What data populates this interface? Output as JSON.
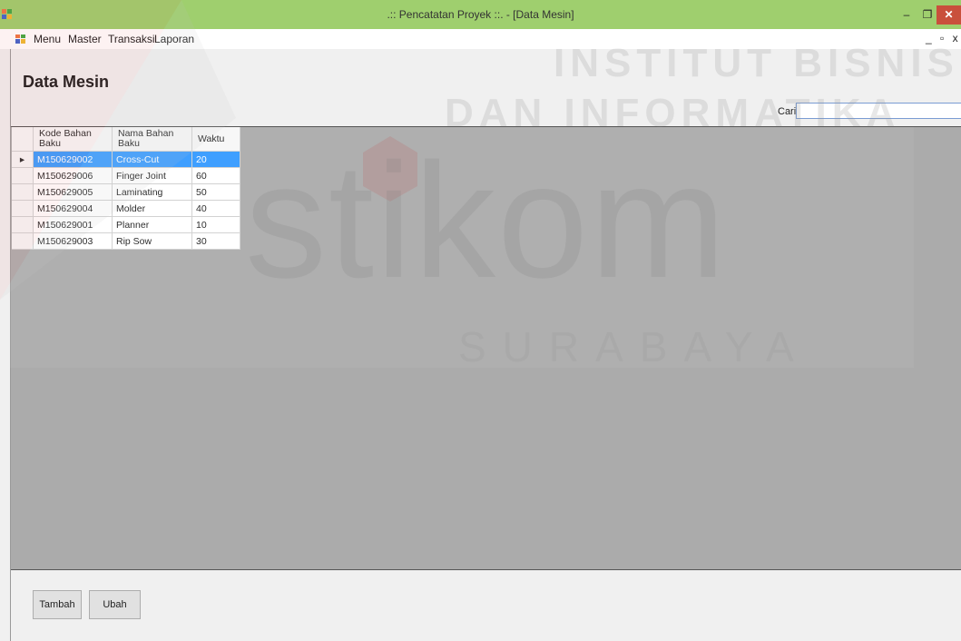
{
  "window": {
    "title": ".:: Pencatatan Proyek ::. - [Data Mesin]",
    "min": "–",
    "max": "❐",
    "close": "✕"
  },
  "menu": {
    "items": [
      "Menu",
      "Master",
      "Transaksi",
      "Laporan"
    ],
    "mdi_controls": "_ ▫ x"
  },
  "page": {
    "title": "Data Mesin"
  },
  "search": {
    "label": "Cari",
    "value": ""
  },
  "grid": {
    "columns": [
      "Kode Bahan Baku",
      "Nama Bahan Baku",
      "Waktu"
    ],
    "rows": [
      [
        "M150629002",
        "Cross-Cut",
        "20"
      ],
      [
        "M150629006",
        "Finger Joint",
        "60"
      ],
      [
        "M150629005",
        "Laminating",
        "50"
      ],
      [
        "M150629004",
        "Molder",
        "40"
      ],
      [
        "M150629001",
        "Planner",
        "10"
      ],
      [
        "M150629003",
        "Rip Sow",
        "30"
      ]
    ],
    "selected_row": 0,
    "row_indicator": "▸"
  },
  "buttons": {
    "add": "Tambah",
    "edit": "Ubah"
  },
  "watermark": {
    "line1": "INSTITUT BISNIS",
    "line2": "DAN INFORMATIKA",
    "brand": "stikom",
    "city": "SURABAYA"
  },
  "colors": {
    "titlebar": "#9fcf6e",
    "selection": "#3399ff",
    "close": "#c9503c",
    "grid_background": "#ababab"
  }
}
